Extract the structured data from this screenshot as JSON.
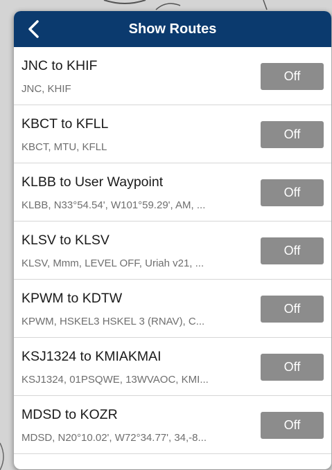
{
  "header": {
    "title": "Show Routes",
    "back_icon": "chevron-left-icon"
  },
  "colors": {
    "header_bg": "#0b3a6e",
    "toggle_off_bg": "#8c8c8c"
  },
  "routes": [
    {
      "title": "JNC to KHIF",
      "waypoints": "JNC, KHIF",
      "toggle": "Off"
    },
    {
      "title": "KBCT to KFLL",
      "waypoints": "KBCT, MTU, KFLL",
      "toggle": "Off"
    },
    {
      "title": "KLBB to User Waypoint",
      "waypoints": "KLBB, N33°54.54', W101°59.29', AM, ...",
      "toggle": "Off"
    },
    {
      "title": "KLSV to KLSV",
      "waypoints": "KLSV, Mmm, LEVEL OFF, Uriah v21, ...",
      "toggle": "Off"
    },
    {
      "title": "KPWM to KDTW",
      "waypoints": "KPWM, HSKEL3 HSKEL 3 (RNAV), C...",
      "toggle": "Off"
    },
    {
      "title": "KSJ1324 to KMIAKMAI",
      "waypoints": "KSJ1324, 01PSQWE, 13WVAOC, KMI...",
      "toggle": "Off"
    },
    {
      "title": "MDSD to KOZR",
      "waypoints": "MDSD, N20°10.02', W72°34.77', 34,-8...",
      "toggle": "Off"
    }
  ]
}
